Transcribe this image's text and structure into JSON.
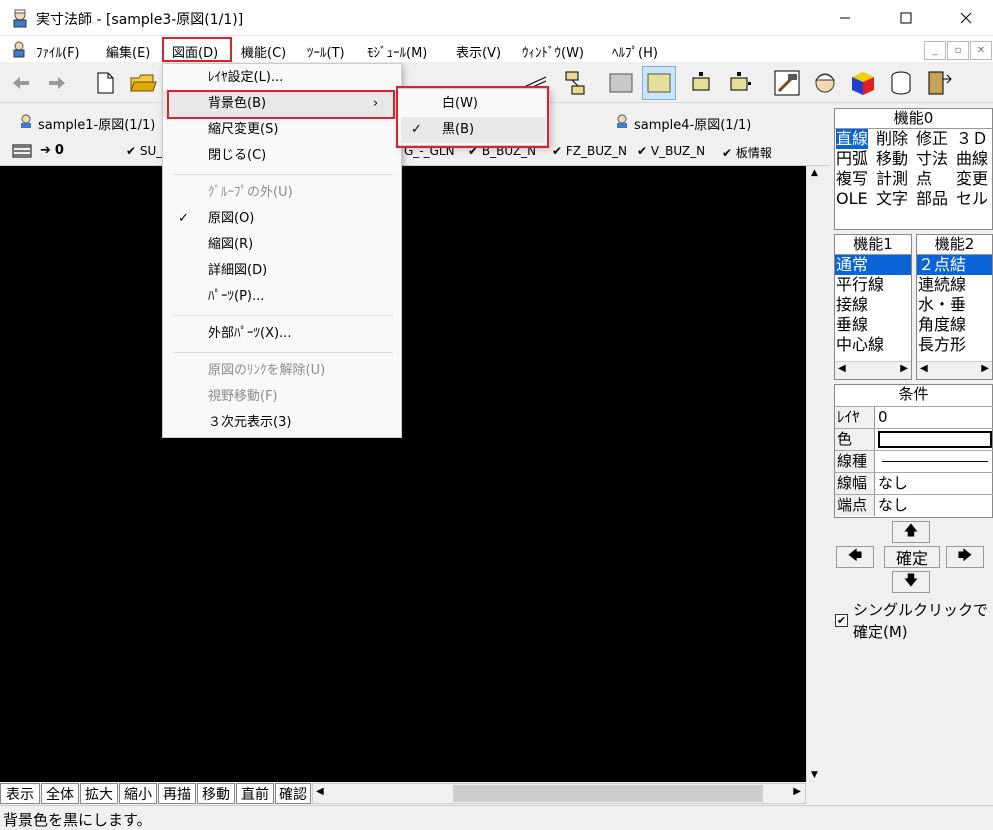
{
  "window": {
    "title": "実寸法師 - [sample3-原図(1/1)]"
  },
  "menubar": {
    "items": [
      "ﾌｧｲﾙ(F)",
      "編集(E)",
      "図面(D)",
      "機能(C)",
      "ﾂｰﾙ(T)",
      "ﾓｼﾞｭｰﾙ(M)",
      "表示(V)",
      "ｳｨﾝﾄﾞｳ(W)",
      "ﾍﾙﾌﾟ(H)"
    ]
  },
  "tabs": [
    "sample1-原図(1/1)",
    "sample4-原図(1/1)"
  ],
  "layerbar": {
    "layer_value": "0",
    "layers": [
      "SU_",
      "G_-_GLN",
      "B_BUZ_N",
      "FZ_BUZ_N",
      "V_BUZ_N",
      "板情報"
    ]
  },
  "dropdown": {
    "items": [
      {
        "label": "ﾚｲﾔ設定(L)...",
        "disabled": false,
        "checked": false,
        "submenu": false
      },
      {
        "label": "背景色(B)",
        "disabled": false,
        "checked": false,
        "submenu": true
      },
      {
        "label": "縮尺変更(S)",
        "disabled": false,
        "checked": false,
        "submenu": false
      },
      {
        "label": "閉じる(C)",
        "disabled": false,
        "checked": false,
        "submenu": false
      },
      {
        "label": "ｸﾞﾙｰﾌﾟの外(U)",
        "disabled": true,
        "checked": false,
        "submenu": false
      },
      {
        "label": "原図(O)",
        "disabled": false,
        "checked": true,
        "submenu": false
      },
      {
        "label": "縮図(R)",
        "disabled": false,
        "checked": false,
        "submenu": false
      },
      {
        "label": "詳細図(D)",
        "disabled": false,
        "checked": false,
        "submenu": false
      },
      {
        "label": "ﾊﾟｰﾂ(P)...",
        "disabled": false,
        "checked": false,
        "submenu": false
      },
      {
        "label": "外部ﾊﾟｰﾂ(X)...",
        "disabled": false,
        "checked": false,
        "submenu": false
      },
      {
        "label": "原図のﾘﾝｸを解除(U)",
        "disabled": true,
        "checked": false,
        "submenu": false
      },
      {
        "label": "視野移動(F)",
        "disabled": true,
        "checked": false,
        "submenu": false
      },
      {
        "label": "３次元表示(3)",
        "disabled": false,
        "checked": false,
        "submenu": false
      }
    ],
    "submenu": [
      {
        "label": "白(W)",
        "checked": false
      },
      {
        "label": "黒(B)",
        "checked": true
      }
    ]
  },
  "panel": {
    "func0": {
      "title": "機能0",
      "cells": [
        "直線",
        "削除",
        "修正",
        "３Ｄ",
        "円弧",
        "移動",
        "寸法",
        "曲線",
        "複写",
        "計測",
        "点",
        "変更",
        "OLE",
        "文字",
        "部品",
        "セル"
      ]
    },
    "func1": {
      "title": "機能1",
      "items": [
        "通常",
        "平行線",
        "接線",
        "垂線",
        "中心線"
      ]
    },
    "func2": {
      "title": "機能2",
      "items": [
        "２点結",
        "連続線",
        "水・垂",
        "角度線",
        "長方形"
      ]
    },
    "cond": {
      "title": "条件",
      "rows": [
        {
          "label": "ﾚｲﾔ",
          "value": "0"
        },
        {
          "label": "色",
          "value": ""
        },
        {
          "label": "線種",
          "value": ""
        },
        {
          "label": "線幅",
          "value": "なし"
        },
        {
          "label": "端点",
          "value": "なし"
        }
      ]
    },
    "confirm_label": "確定",
    "single_click_label_1": "シングルクリックで",
    "single_click_label_2": "確定(M)"
  },
  "bottombar": {
    "buttons": [
      "表示",
      "全体",
      "拡大",
      "縮小",
      "再描",
      "移動",
      "直前",
      "確認"
    ]
  },
  "status": {
    "text": "背景色を黒にします。"
  },
  "colors": {
    "highlight_border": "#e0202a",
    "selection": "#0a64d8",
    "canvas": "#000000"
  }
}
